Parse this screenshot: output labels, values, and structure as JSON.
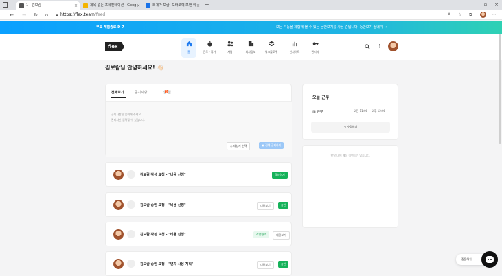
{
  "browser": {
    "tabs": [
      {
        "title": "1 - 김보람",
        "active": true,
        "icon_color": "#555555"
      },
      {
        "title": "제목 없는 프레젠테이션 - Goog",
        "active": false,
        "icon_color": "#f4b400"
      },
      {
        "title": "회계가 보람! 모바로에 보낸 이",
        "active": false,
        "icon_color": "#1a73e8"
      }
    ],
    "url_host": "https://flex.team",
    "url_path": "/feed"
  },
  "banner": {
    "left_text": "무료 체험종료 D-7",
    "right_text": "모든 기능을 체험해 볼 수 있는 동안보기를 사용 중입니다.   동안보기 끝내기 →"
  },
  "header": {
    "logo": "flex",
    "nav": [
      {
        "label": "홈",
        "icon": "home-icon",
        "active": true
      },
      {
        "label": "근무 · 휴가",
        "icon": "stopwatch-icon",
        "active": false
      },
      {
        "label": "사람",
        "icon": "people-icon",
        "active": false
      },
      {
        "label": "회사정보",
        "icon": "building-icon",
        "active": false
      },
      {
        "label": "워크플로우",
        "icon": "stack-icon",
        "active": false
      },
      {
        "label": "인사이트",
        "icon": "bar-chart-icon",
        "active": false
      },
      {
        "label": "관리자",
        "icon": "key-icon",
        "active": false
      }
    ]
  },
  "greeting": "김보람님 안녕하세요! 👋🏻",
  "feed": {
    "tabs": [
      {
        "label": "전체보기",
        "active": true
      },
      {
        "label": "공지사항",
        "active": false
      },
      {
        "label": "할 일",
        "active": false,
        "count": "6"
      }
    ],
    "placeholder_line1": "공지사항을 입력해 주세요.",
    "placeholder_line2": "관리자만 입력할 수 있습니다.",
    "target_button": "대상자 선택",
    "post_button": "전체 공지하기",
    "items": [
      {
        "title": "김보람 작성 요청 - \"비용 신청\"",
        "buttons": [
          {
            "label": "작성하기",
            "style": "green"
          }
        ]
      },
      {
        "title": "김보람 승인 요청 - \"비용 신청\"",
        "buttons": [
          {
            "label": "내용보기",
            "style": "outline"
          },
          {
            "label": "승인",
            "style": "green"
          }
        ]
      },
      {
        "title": "김보람 작성 요청 - \"비용 신청\"",
        "buttons": [
          {
            "label": "작성완료",
            "style": "light"
          },
          {
            "label": "내용보기",
            "style": "outline"
          }
        ]
      },
      {
        "title": "김보람 승인 요청 - \"연차 사용 계획\"",
        "buttons": [
          {
            "label": "내용보기",
            "style": "outline"
          },
          {
            "label": "승인",
            "style": "green"
          }
        ]
      }
    ]
  },
  "today": {
    "title": "오늘 근무",
    "work_label": "근무",
    "work_time": "오전 11:00 ~ 오후 12:00",
    "edit_button": "수정하기",
    "empty_text": "한달 내에 예정 이벤트가 없습니다."
  },
  "float": {
    "ask_label": "질문하기"
  },
  "colors": {
    "accent": "#1f7bf0",
    "green": "#16b25a",
    "banner_start": "#0aa0ff",
    "banner_end": "#2fd1b4"
  }
}
